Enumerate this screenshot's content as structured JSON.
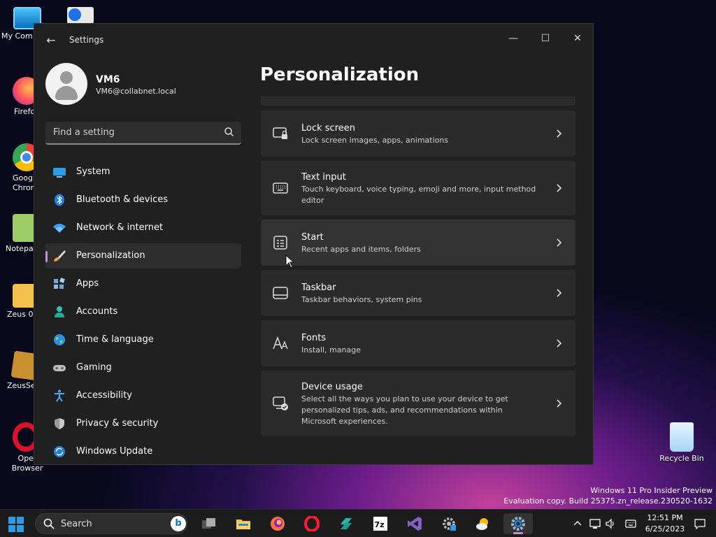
{
  "desktop": {
    "icons": [
      {
        "label": "My Com",
        "name": "my-computer"
      },
      {
        "label": "Firefo",
        "name": "firefox"
      },
      {
        "label": "Goog\nChrom",
        "name": "chrome"
      },
      {
        "label": "Notepa",
        "name": "notepad"
      },
      {
        "label": "Zeus 0.",
        "name": "zeus"
      },
      {
        "label": "ZeusSe",
        "name": "zeusse"
      },
      {
        "label": "Oper\nBrowser",
        "name": "opera"
      },
      {
        "label": "Recycle Bin",
        "name": "recycle-bin"
      }
    ],
    "watermark": {
      "line1": "Windows 11 Pro Insider Preview",
      "line2": "Evaluation copy. Build 25375.zn_release.230520-1632"
    }
  },
  "window": {
    "title": "Settings",
    "back_glyph": "←",
    "min_glyph": "—",
    "max_glyph": "☐",
    "close_glyph": "✕"
  },
  "profile": {
    "name": "VM6",
    "email": "VM6@collabnet.local"
  },
  "search": {
    "placeholder": "Find a setting"
  },
  "nav": {
    "items": [
      {
        "label": "System",
        "icon": "system-icon"
      },
      {
        "label": "Bluetooth & devices",
        "icon": "bluetooth-icon"
      },
      {
        "label": "Network & internet",
        "icon": "network-icon"
      },
      {
        "label": "Personalization",
        "icon": "brush-icon",
        "active": true
      },
      {
        "label": "Apps",
        "icon": "apps-icon"
      },
      {
        "label": "Accounts",
        "icon": "accounts-icon"
      },
      {
        "label": "Time & language",
        "icon": "globe-icon"
      },
      {
        "label": "Gaming",
        "icon": "gamepad-icon"
      },
      {
        "label": "Accessibility",
        "icon": "accessibility-icon"
      },
      {
        "label": "Privacy & security",
        "icon": "shield-icon"
      },
      {
        "label": "Windows Update",
        "icon": "update-icon"
      }
    ]
  },
  "main": {
    "title": "Personalization",
    "cards": [
      {
        "title": "Lock screen",
        "desc": "Lock screen images, apps, animations",
        "icon": "lock-screen-icon"
      },
      {
        "title": "Text input",
        "desc": "Touch keyboard, voice typing, emoji and more, input method editor",
        "icon": "keyboard-icon"
      },
      {
        "title": "Start",
        "desc": "Recent apps and items, folders",
        "icon": "start-icon"
      },
      {
        "title": "Taskbar",
        "desc": "Taskbar behaviors, system pins",
        "icon": "taskbar-icon"
      },
      {
        "title": "Fonts",
        "desc": "Install, manage",
        "icon": "fonts-icon"
      },
      {
        "title": "Device usage",
        "desc": "Select all the ways you plan to use your device to get personalized tips, ads, and recommendations within Microsoft experiences.",
        "icon": "device-usage-icon"
      }
    ]
  },
  "taskbar": {
    "search_placeholder": "Search",
    "apps": [
      "task-view",
      "file-explorer",
      "firefox",
      "opera",
      "app-green",
      "7zip",
      "visual-studio",
      "settings-gear",
      "weather",
      "settings-active"
    ],
    "clock": {
      "time": "12:51 PM",
      "date": "6/25/2023"
    },
    "colors": {
      "accent": "#0078d4",
      "active_indicator": "#c18fd9"
    }
  }
}
